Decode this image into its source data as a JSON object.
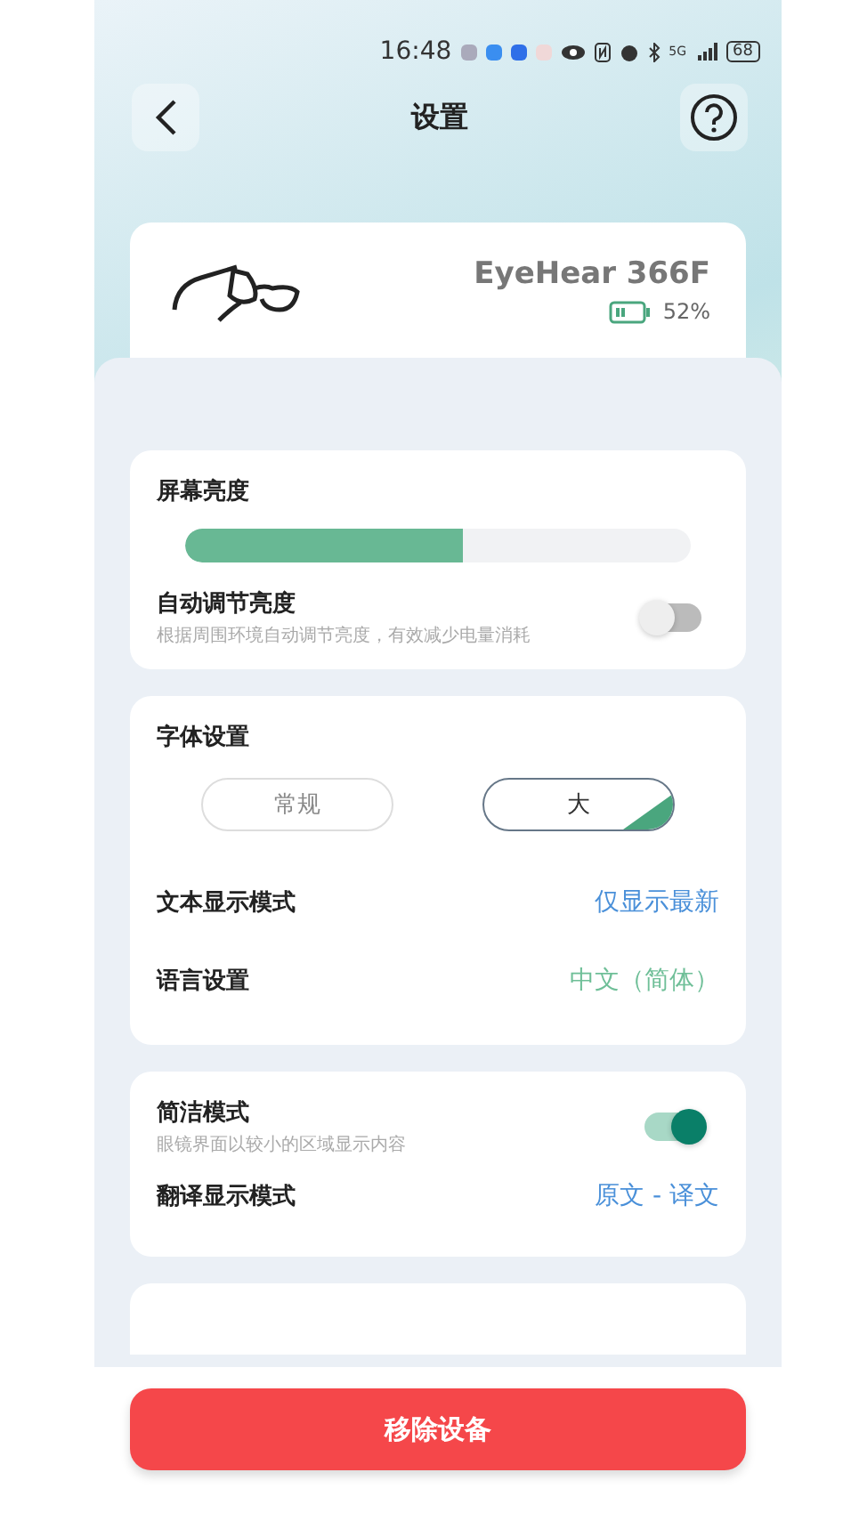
{
  "status_bar": {
    "time": "16:48",
    "network": "5G",
    "battery": "68"
  },
  "header": {
    "title": "设置"
  },
  "device": {
    "name": "EyeHear 366F",
    "battery": "52%"
  },
  "brightness": {
    "title": "屏幕亮度",
    "level": 0.55,
    "auto": {
      "title": "自动调节亮度",
      "subtitle": "根据周围环境自动调节亮度，有效减少电量消耗",
      "on": false
    }
  },
  "font": {
    "title": "字体设置",
    "options": [
      {
        "label": "常规",
        "selected": false
      },
      {
        "label": "大",
        "selected": true
      }
    ],
    "rows": [
      {
        "label": "文本显示模式",
        "value": "仅显示最新",
        "color": "#4a90d9"
      },
      {
        "label": "语言设置",
        "value": "中文（简体）",
        "color": "#6fbf98"
      }
    ]
  },
  "display": {
    "simple_mode": {
      "title": "简洁模式",
      "subtitle": "眼镜界面以较小的区域显示内容",
      "on": true
    },
    "rows": [
      {
        "label": "翻译显示模式",
        "value": "原文 - 译文",
        "color": "#4a90d9"
      }
    ]
  },
  "remove_button": "移除设备"
}
